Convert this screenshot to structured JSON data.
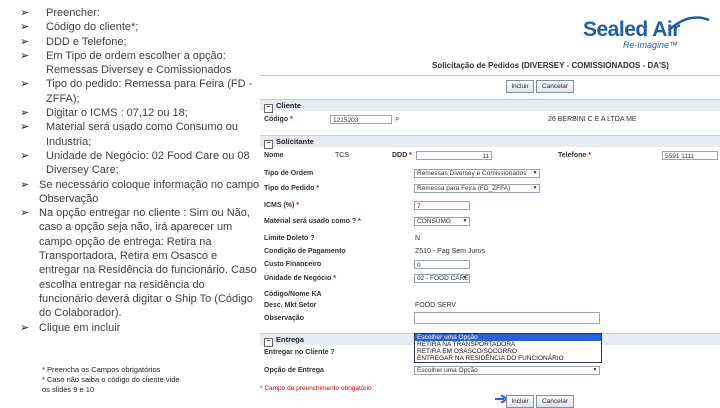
{
  "bullets": [
    "Preencher:",
    "Código do cliente*;",
    "DDD e Telefone;",
    "Em Tipo de ordem escolher a opção: Remessas Diversey e Comissionados",
    "Tipo do pedido: Remessa para Feira (FD - ZFFA);",
    "Digitar o ICMS : 07,12 ou 18;",
    "Material será usado como Consumo ou Industria;",
    "Unidade de Negócio: 02 Food Care ou 08 Diversey Care;",
    "Se necessário coloque informação no campo Observação",
    "Na opção entregar no cliente : Sim ou Não, caso a opção seja não, irá aparecer um campo opção de entrega: Retira na Transportadora, Retira em Osasco e entregar na Residência do funcionário. Caso escolha entregar na residência do funcionário deverá digitar o Ship To (Código do Colaborador).",
    "Clique em incluir"
  ],
  "notes": [
    "* Preencha os Campos obrigatórios",
    "* Caso não saiba o código do cliente vide",
    "os slides 9 e 10"
  ],
  "logo": {
    "name": "Sealed Air",
    "tagline": "Re-imagine™",
    "color": "#1f5fa8"
  },
  "form": {
    "title": "Solicitação de Pedidos (DIVERSEY - COMISSIONADOS - DA'S)",
    "incluir_label": "Incluir",
    "cancelar_label": "Cancelar",
    "cliente_section": "Cliente",
    "codigo_label": "Código",
    "codigo_value": "1215203",
    "cliente_name": "26 BERBINI C E A LTDA ME",
    "solicitante_section": "Solicitante",
    "nome_label": "Nome",
    "nome_value": "TCS",
    "ddd_label": "DDD",
    "ddd_value": "11",
    "telefone_label": "Telefone",
    "telefone_value": "5591 1111",
    "tipo_ordem_label": "Tipo de Ordem",
    "tipo_ordem_value": "Remessas Diversey e Comissionados",
    "tipo_pedido_label": "Tipo do Pedido",
    "tipo_pedido_value": "Remessa para Feira (FD_ZFFA)",
    "icms_label": "ICMS (%)",
    "icms_value": "7",
    "material_label": "Material será usado como ?",
    "material_value": "CONSUMO",
    "limite_label": "Limite Doleto ?",
    "limite_value": "N",
    "condicao_label": "Condição de Pagamento",
    "condicao_value": "Z510 - Pag Sem Juros",
    "custo_label": "Custo Financeiro",
    "custo_value": "0",
    "unidade_label": "Unidade de Negócio",
    "unidade_value": "02 - FOOD CARE",
    "codigo_musa_label": "Código/Nome KA",
    "desc_label": "Desc. Mkt Setor",
    "desc_value": "FOOD SERV",
    "observacao_label": "Observação",
    "entrega_section": "Entrega",
    "entregar_label": "Entregar no Cliente ?",
    "opcao_label": "Opção de Entrega",
    "opcao_value": "Escolher uma Opção",
    "dropdown_options": [
      "Escolher uma Opção",
      "RETIRA NA TRANSPORTADORA",
      "RETIRA EM OSASCO/SOCORRO",
      "ENTREGAR NA RESIDÊNCIA DO FUNCIONÁRIO"
    ],
    "required_note": "* Campo de preenchimento obrigatório"
  }
}
